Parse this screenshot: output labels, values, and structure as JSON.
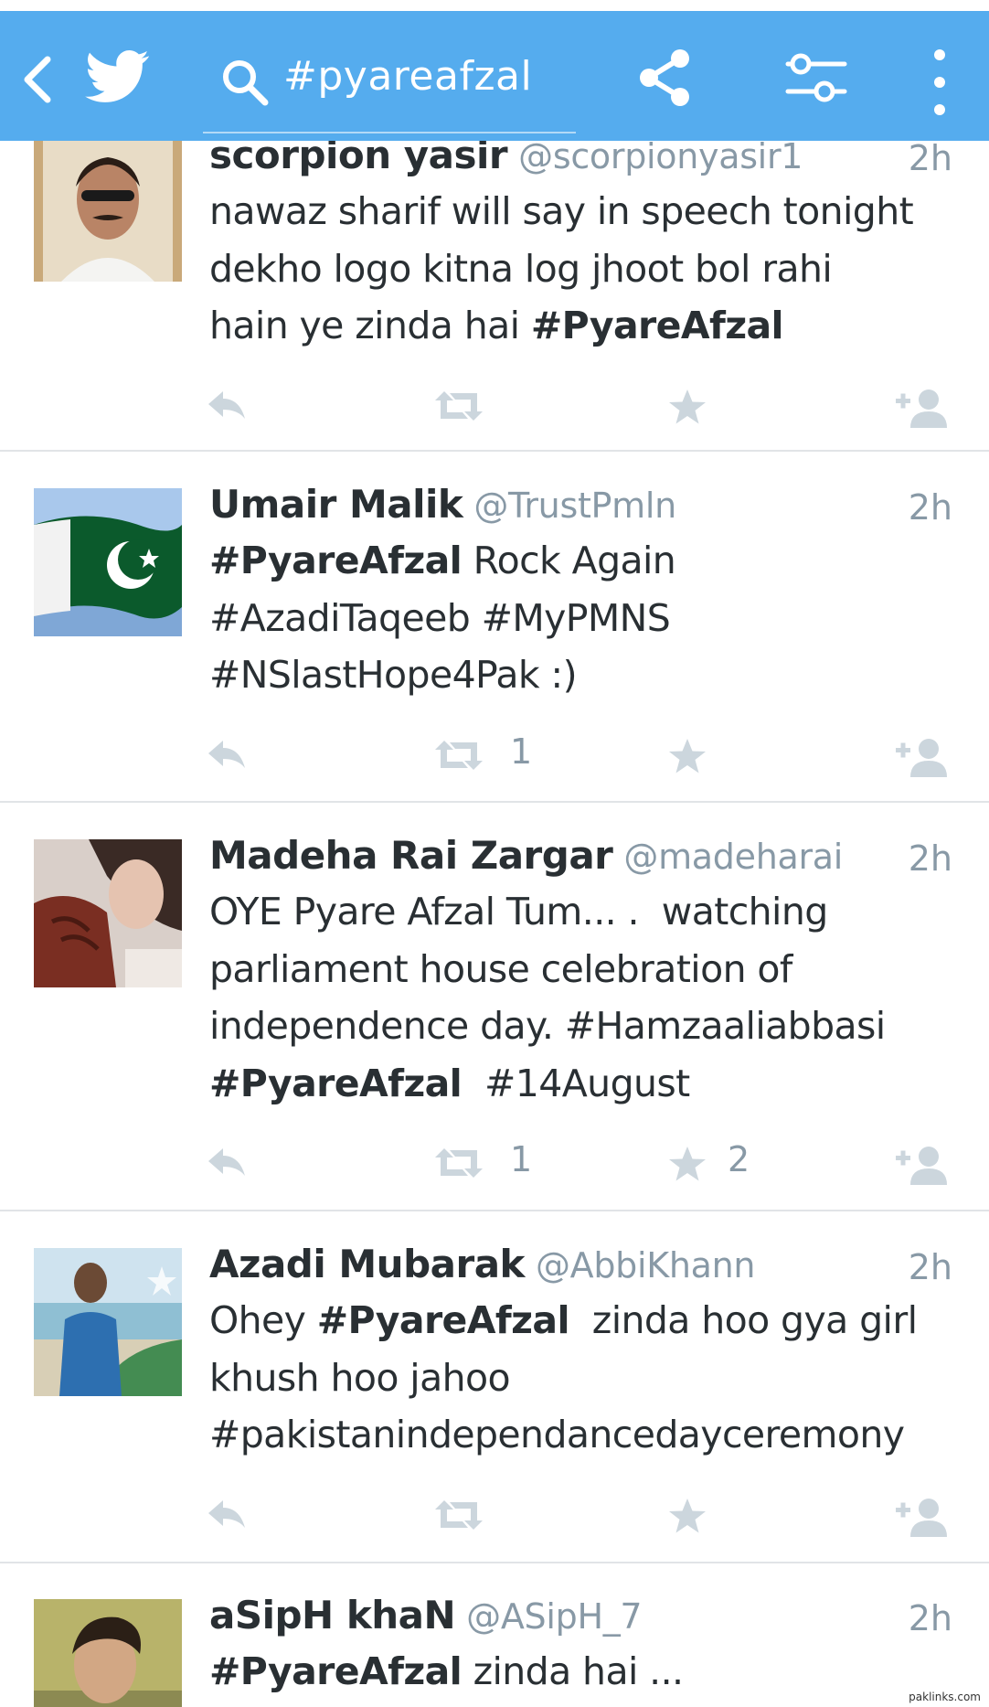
{
  "topbar": {
    "background": "#55acee",
    "back_icon": "chevron-left-icon",
    "logo_icon": "twitter-bird-icon",
    "search_icon": "search-icon",
    "search_query": "#pyareafzal",
    "share_icon": "share-icon",
    "filter_icon": "filter-sliders-icon",
    "more_icon": "overflow-menu-icon"
  },
  "tweets": [
    {
      "name": "scorpion yasir",
      "handle": "@scorpionyasir1",
      "time": "2h",
      "avatar": "profile-photo",
      "text": "nawaz sharif will say in speech tonight dekho logo kitna log jhoot bol rahi hain ye zinda hai #PyareAfzal",
      "lines": [
        [
          {
            "t": "nawaz sharif will say in speech tonight"
          }
        ],
        [
          {
            "t": "dekho logo kitna log jhoot bol rahi"
          }
        ],
        [
          {
            "t": "hain ye zinda hai "
          },
          {
            "t": "#PyareAfzal",
            "b": true
          }
        ]
      ],
      "retweets": "",
      "favorites": ""
    },
    {
      "name": "Umair Malik",
      "handle": "@TrustPmln",
      "time": "2h",
      "avatar": "pakistan-flag",
      "text": "#PyareAfzal Rock Again #AzadiTaqeeb #MyPMNS #NSlastHope4Pak :)",
      "lines": [
        [
          {
            "t": "#PyareAfzal",
            "b": true
          },
          {
            "t": " Rock Again"
          }
        ],
        [
          {
            "t": "#AzadiTaqeeb #MyPMNS"
          }
        ],
        [
          {
            "t": "#NSlastHope4Pak :)"
          }
        ]
      ],
      "retweets": "1",
      "favorites": ""
    },
    {
      "name": "Madeha Rai Zargar",
      "handle": "@madeharai",
      "time": "2h",
      "avatar": "profile-photo",
      "text": "OYE Pyare Afzal Tum... .  watching parliament house celebration of independence day. #Hamzaaliabbasi #PyareAfzal  #14August",
      "lines": [
        [
          {
            "t": "OYE Pyare Afzal Tum... .  watching"
          }
        ],
        [
          {
            "t": "parliament house celebration of"
          }
        ],
        [
          {
            "t": "independence day. #Hamzaaliabbasi"
          }
        ],
        [
          {
            "t": "#PyareAfzal",
            "b": true
          },
          {
            "t": "  #14August"
          }
        ]
      ],
      "retweets": "1",
      "favorites": "2"
    },
    {
      "name": "Azadi Mubarak",
      "handle": "@AbbiKhann",
      "time": "2h",
      "avatar": "profile-photo",
      "text": "Ohey #PyareAfzal  zinda hoo gya girl khush hoo jahoo #pakistanindependancedayceremony",
      "lines": [
        [
          {
            "t": "Ohey "
          },
          {
            "t": "#PyareAfzal",
            "b": true
          },
          {
            "t": "  zinda hoo gya girl"
          }
        ],
        [
          {
            "t": "khush hoo jahoo"
          }
        ],
        [
          {
            "t": "#pakistanindependancedayceremony"
          }
        ]
      ],
      "retweets": "",
      "favorites": ""
    },
    {
      "name": "aSipH khaN",
      "handle": "@ASipH_7",
      "time": "2h",
      "avatar": "profile-photo",
      "text": "#PyareAfzal zinda hai ...",
      "lines": [
        [
          {
            "t": "#PyareAfzal",
            "b": true
          },
          {
            "t": " zinda hai ..."
          }
        ]
      ],
      "retweets": "",
      "favorites": ""
    }
  ],
  "action_icons": {
    "reply": "reply-icon",
    "retweet": "retweet-icon",
    "favorite": "star-icon",
    "follow": "follow-icon"
  },
  "colors": {
    "text": "#292f33",
    "muted": "#8899a6",
    "action_icon": "#ccd6dd",
    "divider": "#e1e4e7"
  },
  "watermark": "paklinks.com"
}
